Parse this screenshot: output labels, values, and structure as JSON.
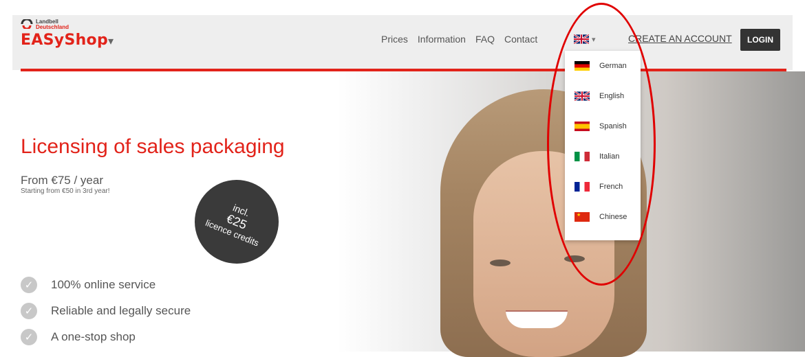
{
  "logo": {
    "brand_line1": "Landbell",
    "brand_line2": "Deutschland",
    "name": "EASyShop",
    "caret": "▾"
  },
  "nav": {
    "items": [
      "Prices",
      "Information",
      "FAQ",
      "Contact"
    ],
    "lang_caret": "▾",
    "create_account": "CREATE AN ACCOUNT",
    "login": "LOGIN"
  },
  "language_menu": {
    "items": [
      {
        "label": "German",
        "flag": "germany-flag-icon"
      },
      {
        "label": "English",
        "flag": "uk-flag-icon"
      },
      {
        "label": "Spanish",
        "flag": "spain-flag-icon"
      },
      {
        "label": "Italian",
        "flag": "italy-flag-icon"
      },
      {
        "label": "French",
        "flag": "france-flag-icon"
      },
      {
        "label": "Chinese",
        "flag": "china-flag-icon"
      }
    ]
  },
  "hero": {
    "title": "Licensing of sales packaging",
    "price": "From €75 / year",
    "subprice": "Starting from €50 in 3rd year!",
    "badge": {
      "line1": "incl.",
      "line2": "€25",
      "line3": "licence credits"
    },
    "features": [
      "100% online service",
      "Reliable and legally secure",
      "A one-stop shop"
    ]
  },
  "colors": {
    "brand_red": "#e2231a",
    "header_bg": "#eeeeee",
    "login_bg": "#333333",
    "annotation": "#e00000"
  }
}
